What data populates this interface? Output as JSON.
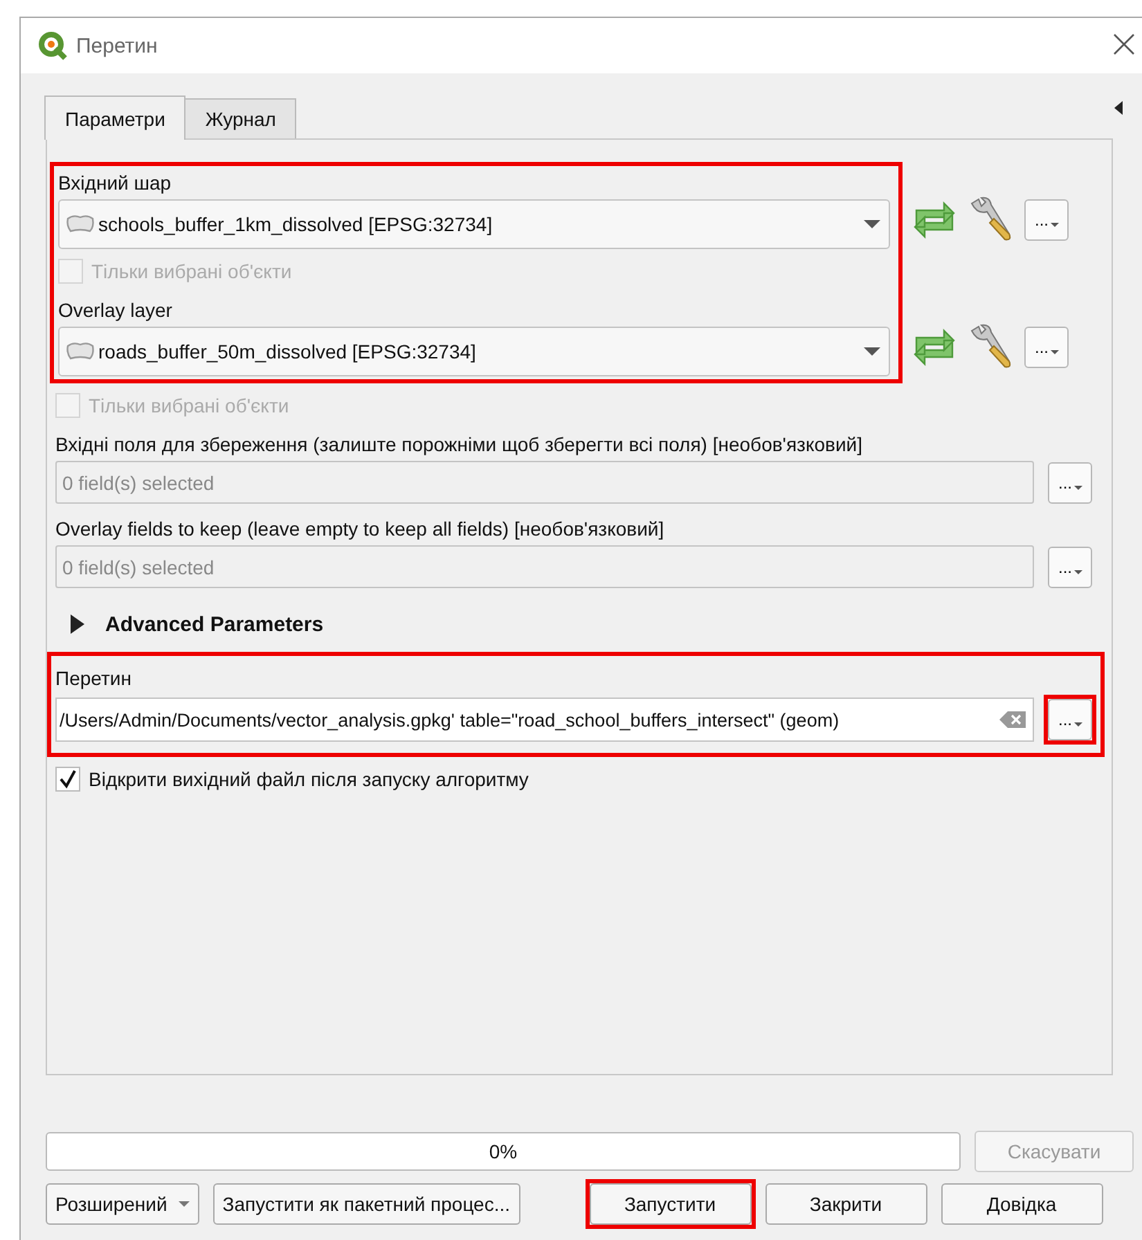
{
  "window": {
    "title": "Перетин"
  },
  "tabs": [
    {
      "label": "Параметри",
      "selected": true
    },
    {
      "label": "Журнал",
      "selected": false
    }
  ],
  "input_group": {
    "highlighted": true,
    "items": [
      {
        "kind": "layer",
        "label": "Вхідний шар",
        "value": "schools_buffer_1km_dissolved [EPSG:32734]",
        "button": "..."
      },
      {
        "kind": "checkbox",
        "label": "Тільки вибрані об'єкти",
        "checked": false,
        "disabled": true
      },
      {
        "kind": "layer",
        "label": "Overlay layer",
        "value": "roads_buffer_50m_dissolved [EPSG:32734]",
        "button": "..."
      }
    ]
  },
  "params": [
    {
      "kind": "checkbox",
      "label": "Тільки вибрані об'єкти",
      "checked": false,
      "disabled": true
    },
    {
      "kind": "fields",
      "label": "Вхідні поля для збереження (залиште порожніми щоб зберегти всі поля) [необов'язковий]",
      "value": "0 field(s) selected",
      "button": "..."
    },
    {
      "kind": "fields",
      "label": "Overlay fields to keep (leave empty to keep all fields) [необов'язковий]",
      "value": "0 field(s) selected",
      "button": "..."
    }
  ],
  "advanced": {
    "label": "Advanced Parameters",
    "expanded": false
  },
  "output": {
    "highlighted": true,
    "label": "Перетин",
    "value": "/Users/Admin/Documents/vector_analysis.gpkg' table=\"road_school_buffers_intersect\" (geom)",
    "button": "...",
    "button_highlighted": true
  },
  "open_after": {
    "label": "Відкрити вихідний файл після запуску алгоритму",
    "checked": true
  },
  "progress": {
    "level": 0,
    "text": "0%"
  },
  "cancel": {
    "label": "Скасувати",
    "disabled": true
  },
  "buttons": [
    {
      "kind": "dropdown",
      "label": "Розширений",
      "highlighted": false
    },
    {
      "kind": "plain",
      "label": "Запустити як пакетний процес...",
      "highlighted": false
    },
    {
      "kind": "plain",
      "label": "Запустити",
      "highlighted": true
    },
    {
      "kind": "plain",
      "label": "Закрити",
      "highlighted": false
    },
    {
      "kind": "plain",
      "label": "Довідка",
      "highlighted": false
    }
  ]
}
